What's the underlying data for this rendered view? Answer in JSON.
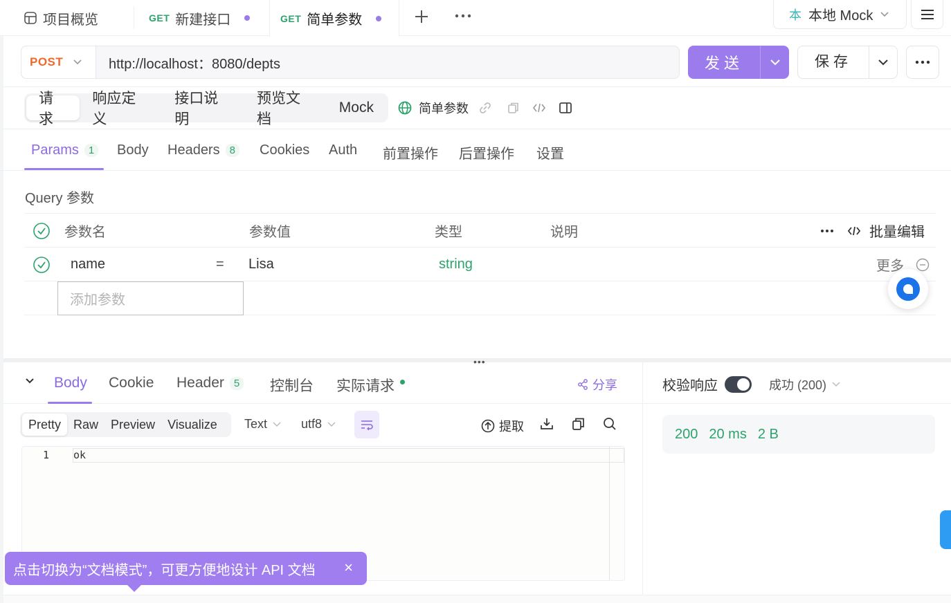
{
  "tabs": [
    {
      "label": "项目概览"
    },
    {
      "method": "GET",
      "label": "新建接口"
    },
    {
      "method": "GET",
      "label": "简单参数"
    }
  ],
  "env": {
    "badge": "本",
    "label": "本地 Mock"
  },
  "request": {
    "method": "POST",
    "url": "http://localhost：8080/depts",
    "send_label": "发送",
    "save_label": "保存"
  },
  "modes": [
    "请求",
    "响应定义",
    "接口说明",
    "预览文档",
    "Mock"
  ],
  "doc_name": "简单参数",
  "param_tabs": [
    {
      "label": "Params",
      "count": "1"
    },
    {
      "label": "Body"
    },
    {
      "label": "Headers",
      "count": "8"
    },
    {
      "label": "Cookies"
    },
    {
      "label": "Auth"
    },
    {
      "label": "前置操作"
    },
    {
      "label": "后置操作"
    },
    {
      "label": "设置"
    }
  ],
  "query": {
    "title": "Query 参数",
    "headers": [
      "参数名",
      "参数值",
      "类型",
      "说明"
    ],
    "bulk_edit": "批量编辑",
    "rows": [
      {
        "name": "name",
        "eq": "=",
        "value": "Lisa",
        "type": "string",
        "more": "更多"
      }
    ],
    "add_placeholder": "添加参数"
  },
  "response": {
    "tabs": [
      {
        "label": "Body"
      },
      {
        "label": "Cookie"
      },
      {
        "label": "Header",
        "count": "5"
      },
      {
        "label": "控制台"
      },
      {
        "label": "实际请求"
      }
    ],
    "share": "分享",
    "formats": [
      "Pretty",
      "Raw",
      "Preview",
      "Visualize"
    ],
    "text_type": "Text",
    "encoding": "utf8",
    "extract": "提取",
    "lines": [
      {
        "no": "1",
        "text": "ok"
      }
    ],
    "verify_label": "校验响应",
    "status_option": "成功 (200)",
    "status": "200",
    "time": "20 ms",
    "size": "2 B"
  },
  "tooltip": "点击切换为“文档模式”，可更方便地设计 API 文档",
  "colors": {
    "accent": "#9c7cec",
    "get": "#2ba36b",
    "post": "#f0692b"
  }
}
